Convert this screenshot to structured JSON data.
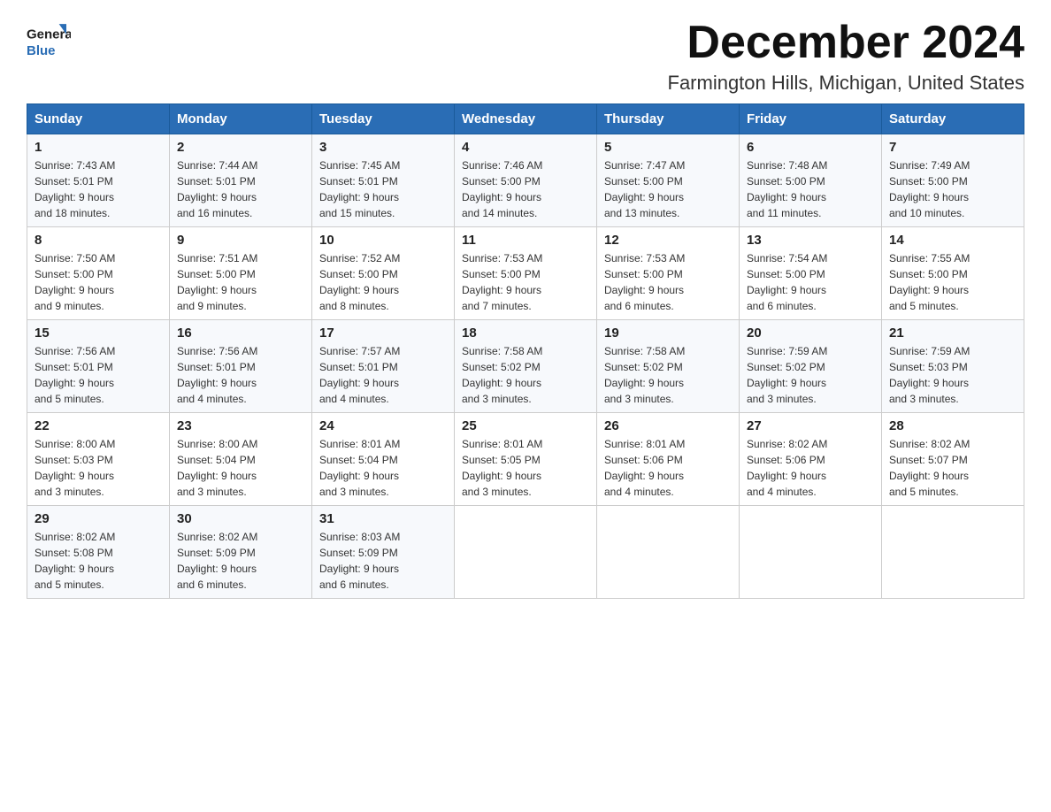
{
  "header": {
    "logo_general": "General",
    "logo_blue": "Blue",
    "month_title": "December 2024",
    "location": "Farmington Hills, Michigan, United States"
  },
  "days_of_week": [
    "Sunday",
    "Monday",
    "Tuesday",
    "Wednesday",
    "Thursday",
    "Friday",
    "Saturday"
  ],
  "weeks": [
    [
      {
        "day": "1",
        "sunrise": "7:43 AM",
        "sunset": "5:01 PM",
        "daylight": "9 hours and 18 minutes."
      },
      {
        "day": "2",
        "sunrise": "7:44 AM",
        "sunset": "5:01 PM",
        "daylight": "9 hours and 16 minutes."
      },
      {
        "day": "3",
        "sunrise": "7:45 AM",
        "sunset": "5:01 PM",
        "daylight": "9 hours and 15 minutes."
      },
      {
        "day": "4",
        "sunrise": "7:46 AM",
        "sunset": "5:00 PM",
        "daylight": "9 hours and 14 minutes."
      },
      {
        "day": "5",
        "sunrise": "7:47 AM",
        "sunset": "5:00 PM",
        "daylight": "9 hours and 13 minutes."
      },
      {
        "day": "6",
        "sunrise": "7:48 AM",
        "sunset": "5:00 PM",
        "daylight": "9 hours and 11 minutes."
      },
      {
        "day": "7",
        "sunrise": "7:49 AM",
        "sunset": "5:00 PM",
        "daylight": "9 hours and 10 minutes."
      }
    ],
    [
      {
        "day": "8",
        "sunrise": "7:50 AM",
        "sunset": "5:00 PM",
        "daylight": "9 hours and 9 minutes."
      },
      {
        "day": "9",
        "sunrise": "7:51 AM",
        "sunset": "5:00 PM",
        "daylight": "9 hours and 9 minutes."
      },
      {
        "day": "10",
        "sunrise": "7:52 AM",
        "sunset": "5:00 PM",
        "daylight": "9 hours and 8 minutes."
      },
      {
        "day": "11",
        "sunrise": "7:53 AM",
        "sunset": "5:00 PM",
        "daylight": "9 hours and 7 minutes."
      },
      {
        "day": "12",
        "sunrise": "7:53 AM",
        "sunset": "5:00 PM",
        "daylight": "9 hours and 6 minutes."
      },
      {
        "day": "13",
        "sunrise": "7:54 AM",
        "sunset": "5:00 PM",
        "daylight": "9 hours and 6 minutes."
      },
      {
        "day": "14",
        "sunrise": "7:55 AM",
        "sunset": "5:00 PM",
        "daylight": "9 hours and 5 minutes."
      }
    ],
    [
      {
        "day": "15",
        "sunrise": "7:56 AM",
        "sunset": "5:01 PM",
        "daylight": "9 hours and 5 minutes."
      },
      {
        "day": "16",
        "sunrise": "7:56 AM",
        "sunset": "5:01 PM",
        "daylight": "9 hours and 4 minutes."
      },
      {
        "day": "17",
        "sunrise": "7:57 AM",
        "sunset": "5:01 PM",
        "daylight": "9 hours and 4 minutes."
      },
      {
        "day": "18",
        "sunrise": "7:58 AM",
        "sunset": "5:02 PM",
        "daylight": "9 hours and 3 minutes."
      },
      {
        "day": "19",
        "sunrise": "7:58 AM",
        "sunset": "5:02 PM",
        "daylight": "9 hours and 3 minutes."
      },
      {
        "day": "20",
        "sunrise": "7:59 AM",
        "sunset": "5:02 PM",
        "daylight": "9 hours and 3 minutes."
      },
      {
        "day": "21",
        "sunrise": "7:59 AM",
        "sunset": "5:03 PM",
        "daylight": "9 hours and 3 minutes."
      }
    ],
    [
      {
        "day": "22",
        "sunrise": "8:00 AM",
        "sunset": "5:03 PM",
        "daylight": "9 hours and 3 minutes."
      },
      {
        "day": "23",
        "sunrise": "8:00 AM",
        "sunset": "5:04 PM",
        "daylight": "9 hours and 3 minutes."
      },
      {
        "day": "24",
        "sunrise": "8:01 AM",
        "sunset": "5:04 PM",
        "daylight": "9 hours and 3 minutes."
      },
      {
        "day": "25",
        "sunrise": "8:01 AM",
        "sunset": "5:05 PM",
        "daylight": "9 hours and 3 minutes."
      },
      {
        "day": "26",
        "sunrise": "8:01 AM",
        "sunset": "5:06 PM",
        "daylight": "9 hours and 4 minutes."
      },
      {
        "day": "27",
        "sunrise": "8:02 AM",
        "sunset": "5:06 PM",
        "daylight": "9 hours and 4 minutes."
      },
      {
        "day": "28",
        "sunrise": "8:02 AM",
        "sunset": "5:07 PM",
        "daylight": "9 hours and 5 minutes."
      }
    ],
    [
      {
        "day": "29",
        "sunrise": "8:02 AM",
        "sunset": "5:08 PM",
        "daylight": "9 hours and 5 minutes."
      },
      {
        "day": "30",
        "sunrise": "8:02 AM",
        "sunset": "5:09 PM",
        "daylight": "9 hours and 6 minutes."
      },
      {
        "day": "31",
        "sunrise": "8:03 AM",
        "sunset": "5:09 PM",
        "daylight": "9 hours and 6 minutes."
      },
      null,
      null,
      null,
      null
    ]
  ],
  "labels": {
    "sunrise": "Sunrise:",
    "sunset": "Sunset:",
    "daylight": "Daylight:"
  }
}
